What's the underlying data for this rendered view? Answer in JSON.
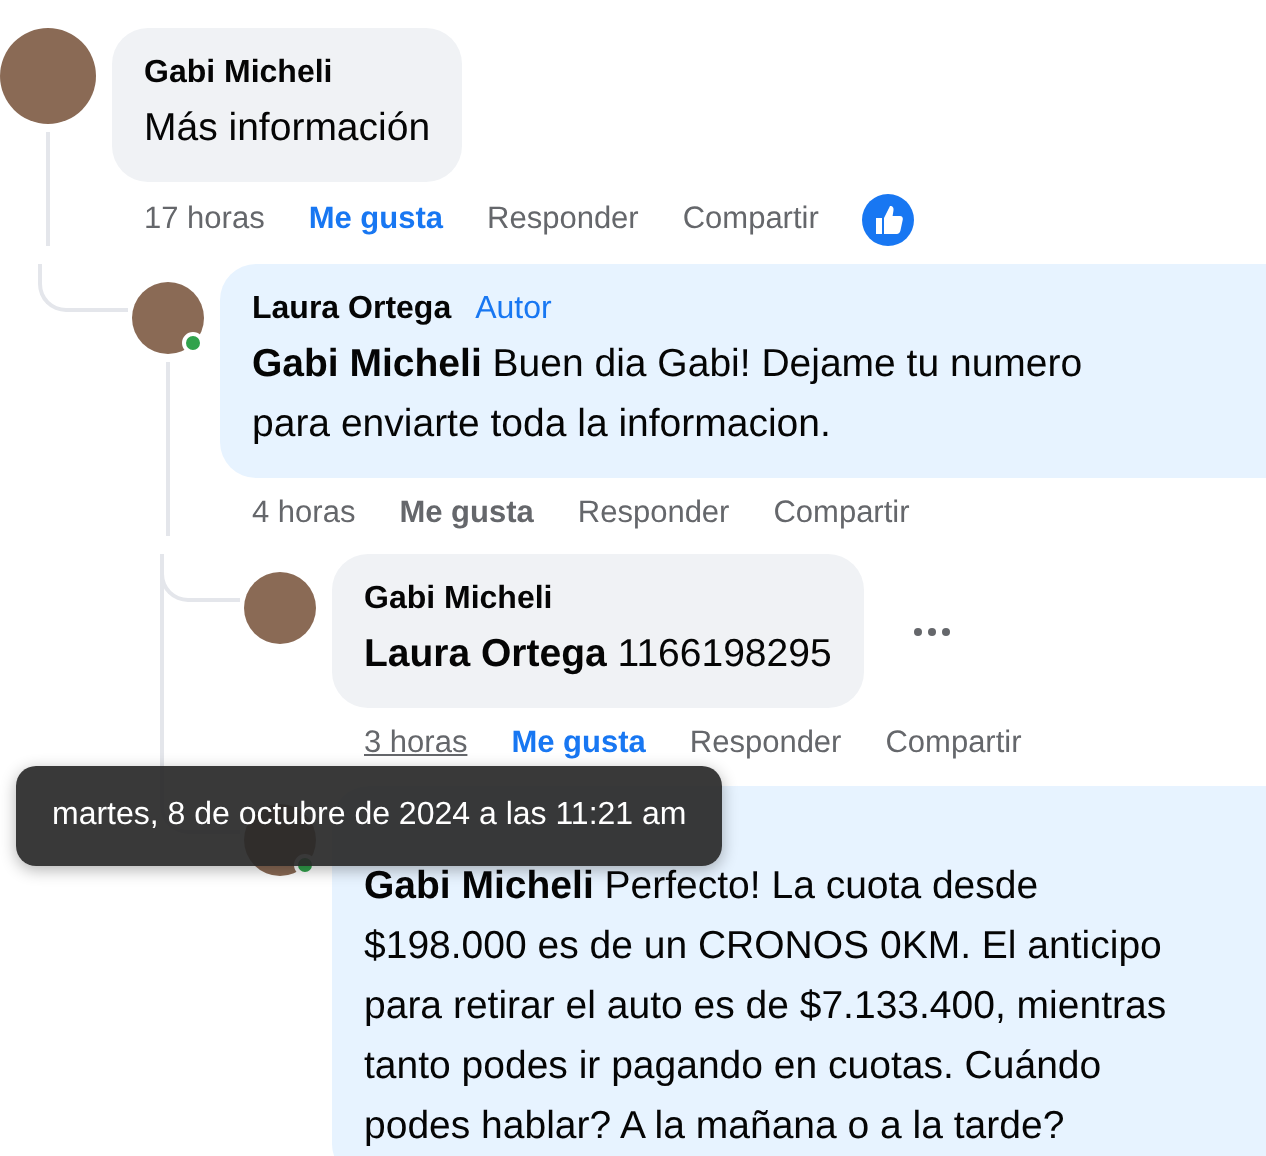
{
  "comments": [
    {
      "author": "Gabi Micheli",
      "online": false,
      "text": "Más información",
      "time": "17 horas",
      "time_hovered": false,
      "like_label": "Me gusta",
      "liked": true,
      "reply_label": "Responder",
      "share_label": "Compartir",
      "like_reaction": true,
      "children": [
        {
          "author": "Laura Ortega",
          "badge": "Autor",
          "online": true,
          "text": "**Gabi Micheli** Buen dia Gabi! Dejame tu numero para enviarte toda la informacion.",
          "time": "4 horas",
          "time_hovered": false,
          "like_label": "Me gusta",
          "liked": false,
          "reply_label": "Responder",
          "share_label": "Compartir",
          "children": [
            {
              "author": "Gabi Micheli",
              "online": false,
              "text": "**Laura Ortega** 1166198295",
              "time": "3 horas",
              "time_hovered": true,
              "like_label": "Me gusta",
              "liked": true,
              "reply_label": "Responder",
              "share_label": "Compartir",
              "menu_button": true
            },
            {
              "author_hidden": true,
              "author_tag_bubble": true,
              "online": true,
              "text": "**Gabi Micheli** Perfecto! La cuota desde $198.000 es de un CRONOS 0KM. El anticipo para retirar el auto es de $7.133.400, mientras tanto podes ir pagando en cuotas. Cuándo podes hablar? A la mañana o a la tarde?"
            }
          ]
        }
      ]
    }
  ],
  "tooltip": "martes, 8 de octubre de 2024 a las 11:21 am"
}
